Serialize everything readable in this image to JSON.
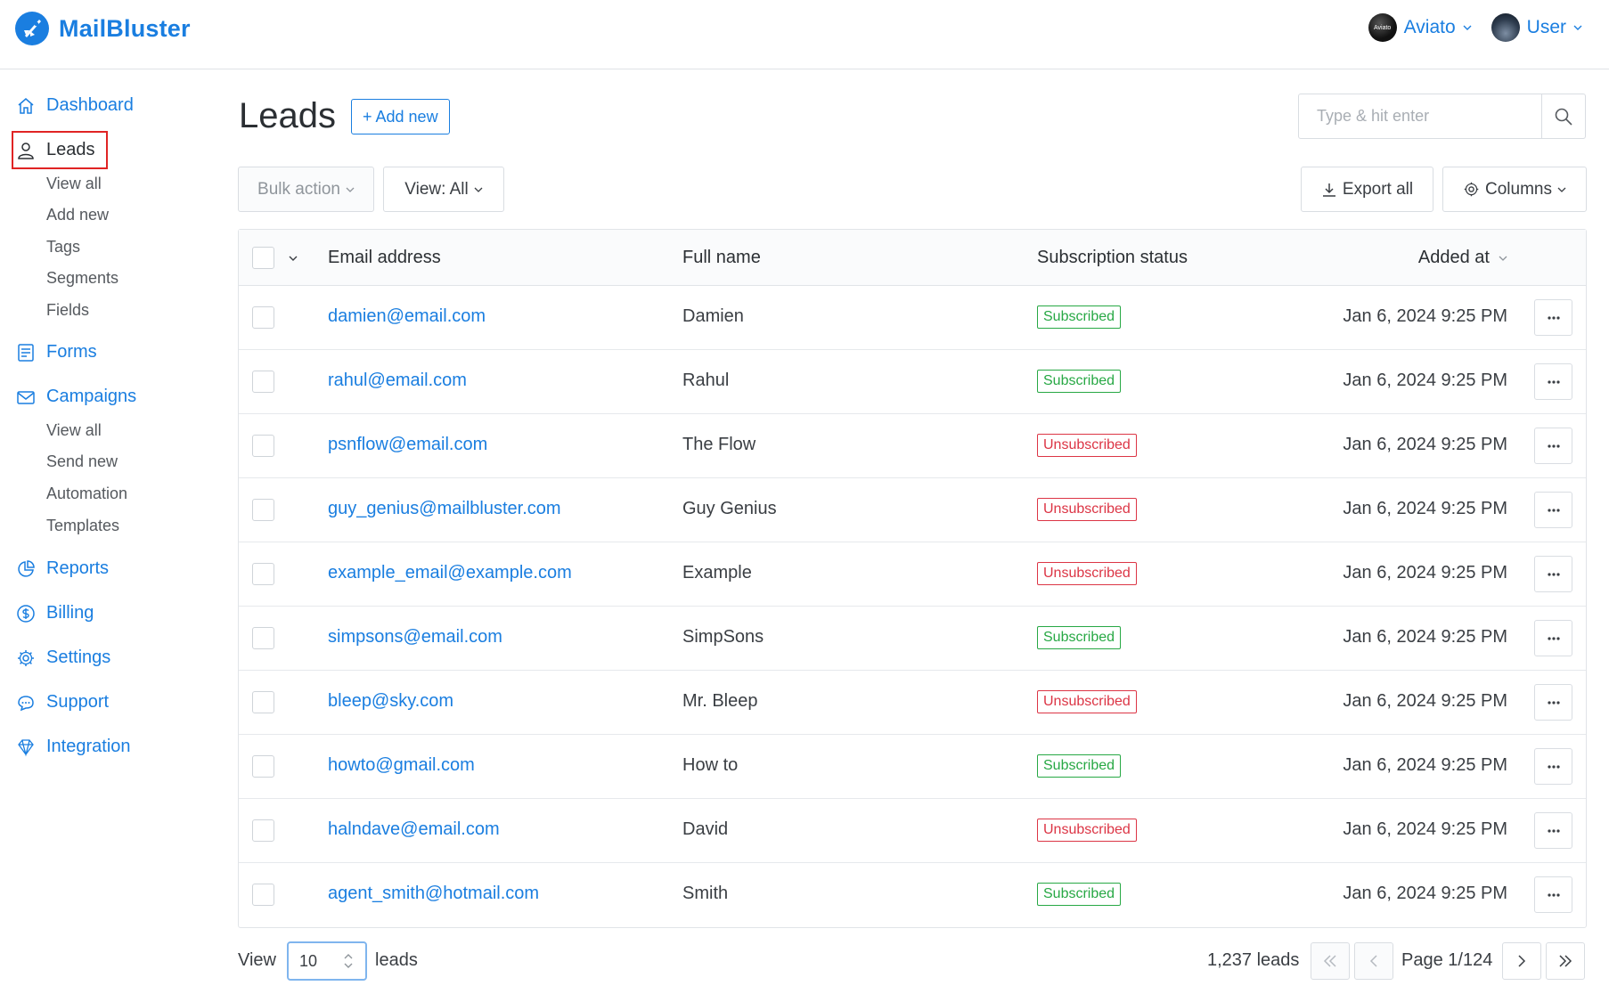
{
  "brand": {
    "name": "MailBluster"
  },
  "topnav": {
    "org": "Aviato",
    "user": "User",
    "org_avatar_text": "Aviato"
  },
  "sidebar": {
    "dashboard": "Dashboard",
    "leads": "Leads",
    "leads_sub": [
      "View all",
      "Add new",
      "Tags",
      "Segments",
      "Fields"
    ],
    "forms": "Forms",
    "campaigns": "Campaigns",
    "campaigns_sub": [
      "View all",
      "Send new",
      "Automation",
      "Templates"
    ],
    "reports": "Reports",
    "billing": "Billing",
    "settings": "Settings",
    "support": "Support",
    "integration": "Integration"
  },
  "page": {
    "title": "Leads",
    "add_new": "+ Add new"
  },
  "search": {
    "placeholder": "Type & hit enter"
  },
  "toolbar": {
    "bulk_action": "Bulk action",
    "view": "View: All",
    "export": "Export all",
    "columns": "Columns"
  },
  "table": {
    "headers": {
      "email": "Email address",
      "name": "Full name",
      "status": "Subscription status",
      "added": "Added at"
    },
    "rows": [
      {
        "email": "damien@email.com",
        "name": "Damien",
        "status": "Subscribed",
        "added": "Jan 6, 2024 9:25 PM"
      },
      {
        "email": "rahul@email.com",
        "name": "Rahul",
        "status": "Subscribed",
        "added": "Jan 6, 2024 9:25 PM"
      },
      {
        "email": "psnflow@email.com",
        "name": "The Flow",
        "status": "Unsubscribed",
        "added": "Jan 6, 2024 9:25 PM"
      },
      {
        "email": "guy_genius@mailbluster.com",
        "name": "Guy Genius",
        "status": "Unsubscribed",
        "added": "Jan 6, 2024 9:25 PM"
      },
      {
        "email": "example_email@example.com",
        "name": "Example",
        "status": "Unsubscribed",
        "added": "Jan 6, 2024 9:25 PM"
      },
      {
        "email": "simpsons@email.com",
        "name": "SimpSons",
        "status": "Subscribed",
        "added": "Jan 6, 2024 9:25 PM"
      },
      {
        "email": "bleep@sky.com",
        "name": "Mr. Bleep",
        "status": "Unsubscribed",
        "added": "Jan 6, 2024 9:25 PM"
      },
      {
        "email": "howto@gmail.com",
        "name": "How to",
        "status": "Subscribed",
        "added": "Jan 6, 2024 9:25 PM"
      },
      {
        "email": "halndave@email.com",
        "name": "David",
        "status": "Unsubscribed",
        "added": "Jan 6, 2024 9:25 PM"
      },
      {
        "email": "agent_smith@hotmail.com",
        "name": "Smith",
        "status": "Subscribed",
        "added": "Jan 6, 2024 9:25 PM"
      }
    ]
  },
  "footer": {
    "view": "View",
    "per_page": "10",
    "leads": "leads",
    "total": "1,237 leads",
    "page": "Page 1/124"
  },
  "colors": {
    "accent": "#1a7ee0",
    "subscribed": "#27a844",
    "unsubscribed": "#dc3545",
    "highlight": "#e02424"
  }
}
